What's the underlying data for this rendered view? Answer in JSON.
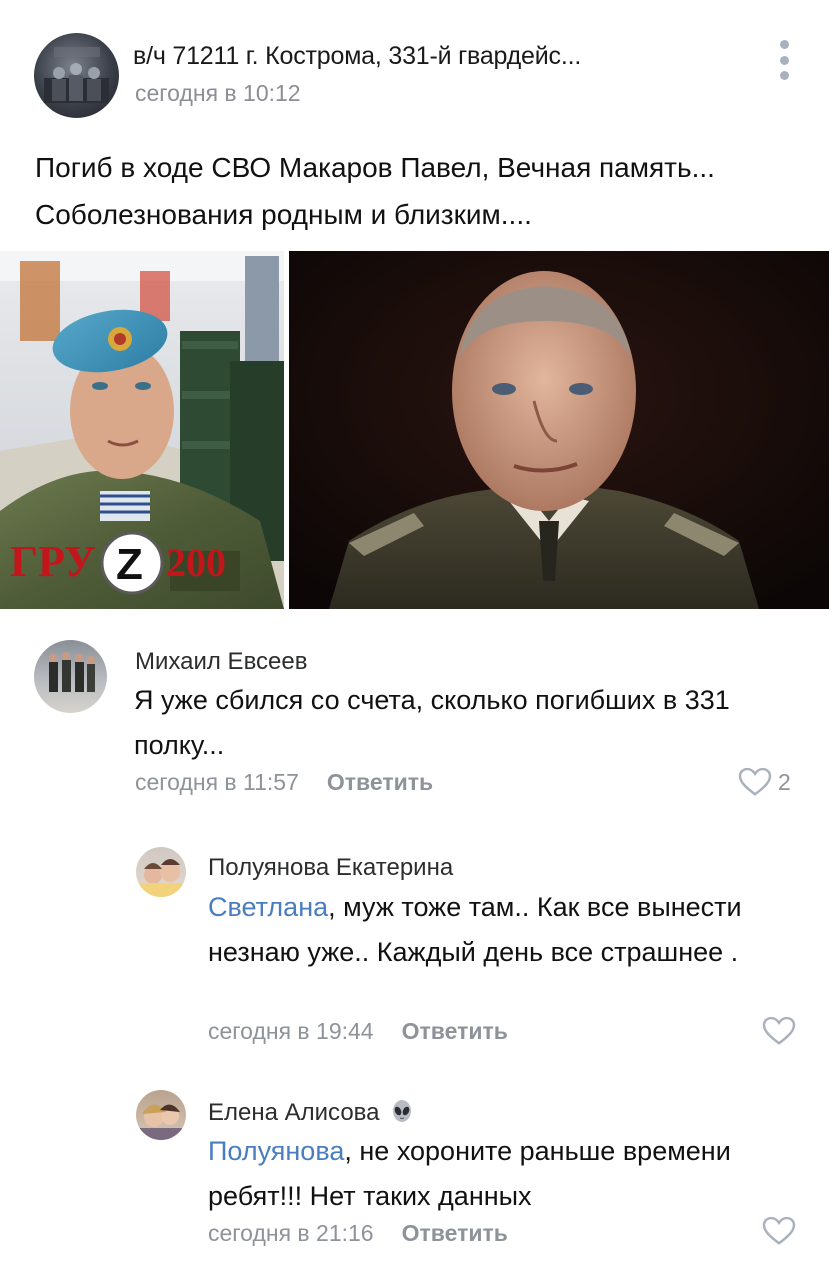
{
  "post": {
    "group_name": "в/ч 71211 г. Кострома, 331-й гвардейс...",
    "time": "сегодня в 10:12",
    "text": "Погиб в ходе СВО  Макаров Павел, Вечная память... Соболезнования родным и близким....",
    "image_overlay": "ГРУZ200"
  },
  "comments": [
    {
      "author": "Михаил Евсеев",
      "mention": "",
      "text": "Я уже сбился со счета, сколько погибших в 331 полку...",
      "time": "сегодня в 11:57",
      "reply_label": "Ответить",
      "likes": "2"
    },
    {
      "author": "Полуянова Екатерина",
      "mention": "Светлана",
      "text": ", муж тоже там.. Как все вынести незнаю уже.. Каждый день все страшнее .",
      "time": "сегодня в 19:44",
      "reply_label": "Ответить",
      "likes": ""
    },
    {
      "author": "Елена Алисова",
      "author_emoji": "👽",
      "mention": "Полуянова",
      "text": ", не хороните раньше времени ребят!!! Нет таких данных",
      "time": "сегодня в 21:16",
      "reply_label": "Ответить",
      "likes": ""
    }
  ],
  "colors": {
    "link": "#4a7dbf",
    "meta": "#8e939a",
    "icon": "#a9b1bc",
    "overlay_red": "#c2161b"
  }
}
